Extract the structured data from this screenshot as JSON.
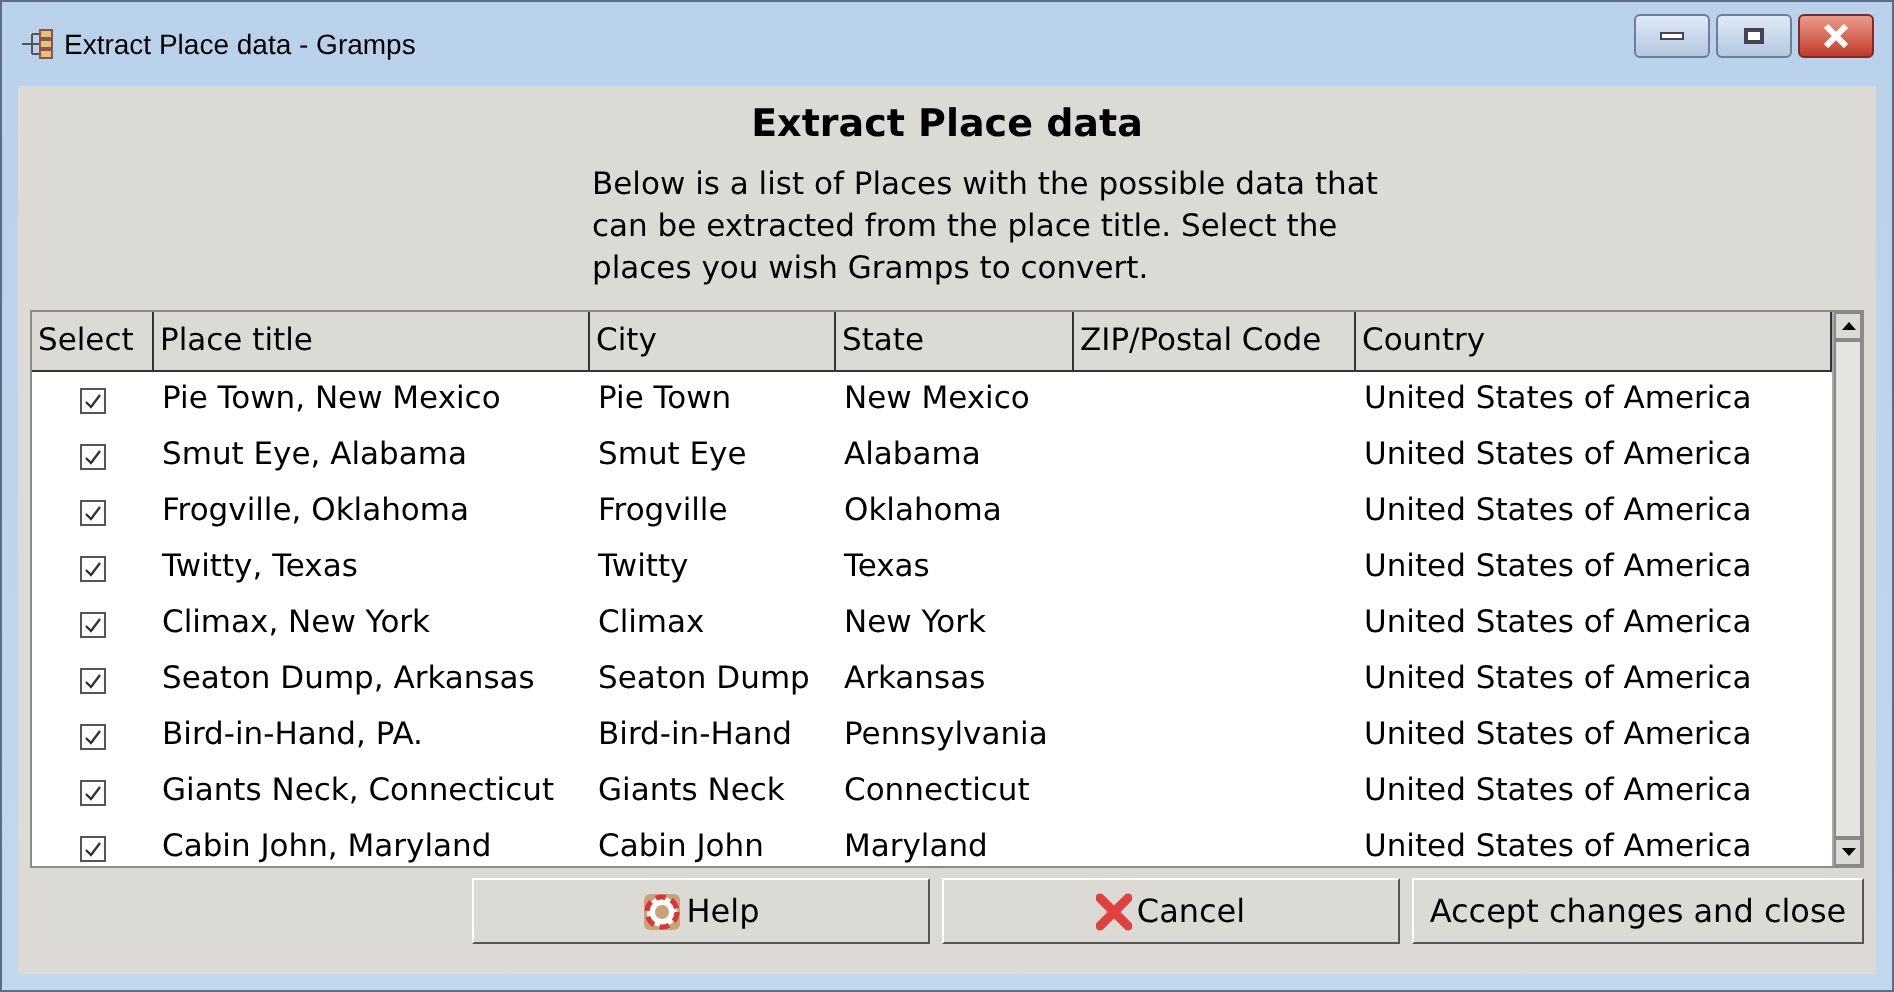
{
  "window": {
    "title": "Extract Place data - Gramps"
  },
  "heading": "Extract Place data",
  "description": "Below is a list of Places with the possible data that can be extracted from the place title. Select the places you wish Gramps to convert.",
  "table": {
    "columns": [
      "Select",
      "Place title",
      "City",
      "State",
      "ZIP/Postal Code",
      "Country"
    ],
    "rows": [
      {
        "checked": true,
        "place_title": "Pie Town, New Mexico",
        "city": "Pie Town",
        "state": "New Mexico",
        "country": "United States of America"
      },
      {
        "checked": true,
        "place_title": "Smut Eye, Alabama",
        "city": "Smut Eye",
        "state": "Alabama",
        "country": "United States of America"
      },
      {
        "checked": true,
        "place_title": "Frogville, Oklahoma",
        "city": "Frogville",
        "state": "Oklahoma",
        "country": "United States of America"
      },
      {
        "checked": true,
        "place_title": "Twitty, Texas",
        "city": "Twitty",
        "state": "Texas",
        "country": "United States of America"
      },
      {
        "checked": true,
        "place_title": "Climax, New York",
        "city": "Climax",
        "state": "New York",
        "country": "United States of America"
      },
      {
        "checked": true,
        "place_title": "Seaton Dump, Arkansas",
        "city": "Seaton Dump",
        "state": "Arkansas",
        "country": "United States of America"
      },
      {
        "checked": true,
        "place_title": "Bird-in-Hand, PA.",
        "city": "Bird-in-Hand",
        "state": "Pennsylvania",
        "country": "United States of America"
      },
      {
        "checked": true,
        "place_title": "Giants Neck, Connecticut",
        "city": "Giants Neck",
        "state": "Connecticut",
        "country": "United States of America"
      },
      {
        "checked": true,
        "place_title": "Cabin John, Maryland",
        "city": "Cabin John",
        "state": "Maryland",
        "country": "United States of America"
      }
    ]
  },
  "buttons": [
    {
      "kind": "help",
      "label": "Help"
    },
    {
      "kind": "cancel",
      "label": "Cancel"
    },
    {
      "kind": "accept",
      "label": "Accept changes and close"
    }
  ]
}
